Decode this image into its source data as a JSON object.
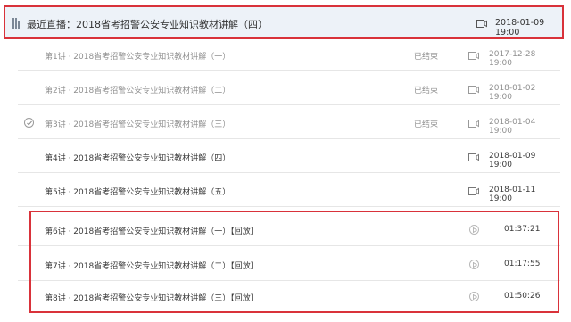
{
  "header": {
    "title": "最近直播：2018省考招警公安专业知识教材讲解（四）",
    "time": "2018-01-09 19:00"
  },
  "lessons": [
    {
      "label": "第1讲 · 2018省考招警公安专业知识教材讲解（一）",
      "status": "已结束",
      "time": "2017-12-28 19:00"
    },
    {
      "label": "第2讲 · 2018省考招警公安专业知识教材讲解（二）",
      "status": "已结束",
      "time": "2018-01-02 19:00"
    },
    {
      "label": "第3讲 · 2018省考招警公安专业知识教材讲解（三）",
      "status": "已结束",
      "time": "2018-01-04 19:00"
    },
    {
      "label": "第4讲 · 2018省考招警公安专业知识教材讲解（四）",
      "status": "",
      "time": "2018-01-09 19:00"
    },
    {
      "label": "第5讲 · 2018省考招警公安专业知识教材讲解（五）",
      "status": "",
      "time": "2018-01-11 19:00"
    }
  ],
  "replays": [
    {
      "label": "第6讲 · 2018省考招警公安专业知识教材讲解（一）【回放】",
      "duration": "01:37:21"
    },
    {
      "label": "第7讲 · 2018省考招警公安专业知识教材讲解（二）【回放】",
      "duration": "01:17:55"
    },
    {
      "label": "第8讲 · 2018省考招警公安专业知识教材讲解（三）【回放】",
      "duration": "01:50:26"
    }
  ],
  "colors": {
    "highlight_border": "#d9323a",
    "header_bg": "#edf2f8"
  },
  "icons": {
    "live": "live-bars-icon",
    "camera": "video-camera-icon",
    "play": "play-circle-icon",
    "check": "check-circle-icon"
  }
}
